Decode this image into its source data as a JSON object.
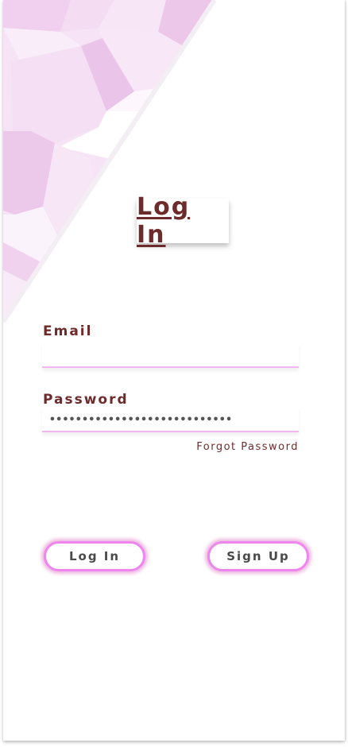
{
  "heading": {
    "title": "Log In"
  },
  "form": {
    "email_label": "Email",
    "email_value": "",
    "password_label": "Password",
    "password_masked": "••••••••••••••••••••••••••••",
    "forgot_link": "Forgot Password"
  },
  "actions": {
    "login_label": "Log In",
    "signup_label": "Sign Up"
  },
  "colors": {
    "text_primary": "#6e2b2b",
    "accent_pink": "#ee86ee",
    "input_underline": "#f3b6f3",
    "background": "#ffffff"
  }
}
